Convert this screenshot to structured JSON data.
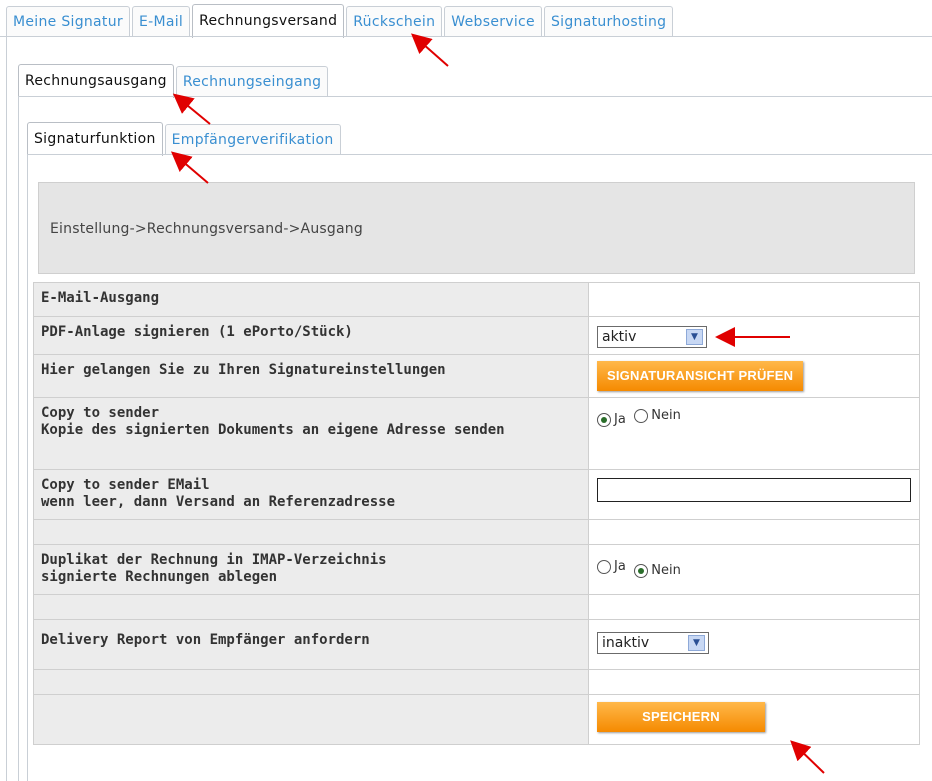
{
  "tabs_level1": [
    {
      "label": "Meine Signatur",
      "active": false
    },
    {
      "label": "E-Mail",
      "active": false
    },
    {
      "label": "Rechnungsversand",
      "active": true
    },
    {
      "label": "Rückschein",
      "active": false
    },
    {
      "label": "Webservice",
      "active": false
    },
    {
      "label": "Signaturhosting",
      "active": false
    }
  ],
  "tabs_level2": [
    {
      "label": "Rechnungsausgang",
      "active": true
    },
    {
      "label": "Rechnungseingang",
      "active": false
    }
  ],
  "tabs_level3": [
    {
      "label": "Signaturfunktion",
      "active": true
    },
    {
      "label": "Empfängerverifikation",
      "active": false
    }
  ],
  "breadcrumb": "Einstellung->Rechnungsversand->Ausgang",
  "form": {
    "email_ausgang": "E-Mail-Ausgang",
    "pdf_sign_label": "PDF-Anlage signieren (1 ePorto/Stück)",
    "pdf_sign_value": "aktiv",
    "sig_settings_label": "Hier gelangen Sie zu Ihren Signatureinstellungen",
    "sig_button": "SIGNATURANSICHT PRÜFEN",
    "cts_label1": "Copy to sender",
    "cts_label2": "Kopie des signierten Dokuments an eigene Adresse senden",
    "ja": "Ja",
    "nein": "Nein",
    "cts_email_label1": "Copy to sender EMail",
    "cts_email_label2": "wenn leer, dann Versand an Referenzadresse",
    "cts_email_value": "",
    "dup_label1": "Duplikat der Rechnung in IMAP-Verzeichnis",
    "dup_label2": "signierte Rechnungen ablegen",
    "delivery_label": "Delivery Report von Empfänger anfordern",
    "delivery_value": "inaktiv",
    "save_button": "SPEICHERN"
  },
  "colors": {
    "tab_link": "#3a8fd1",
    "button": "#f58a00",
    "annotation_arrow": "#e00000"
  }
}
